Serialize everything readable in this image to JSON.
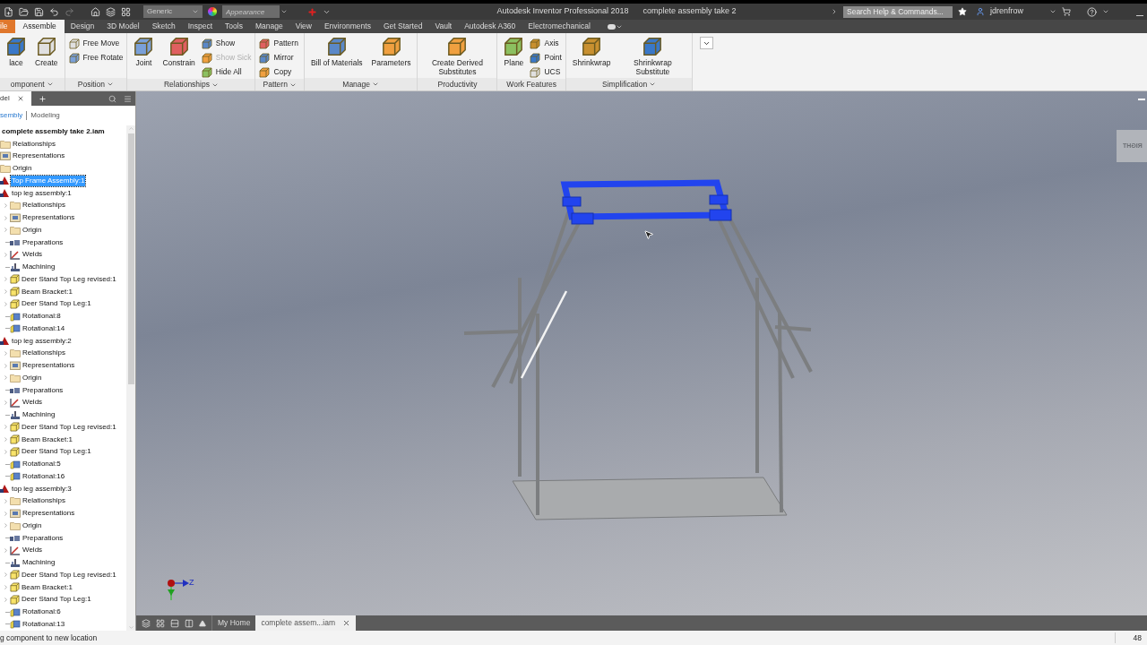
{
  "title_bar": {
    "app": "Autodesk Inventor Professional 2018",
    "document": "complete assembly take 2",
    "material": "Generic",
    "appearance": {
      "placeholder": "Appearance"
    },
    "search": {
      "placeholder": "Search Help & Commands..."
    },
    "user": "jdrenfrow"
  },
  "ribbon_tabs": [
    {
      "label": "ile",
      "selected": false,
      "kind": "file"
    },
    {
      "label": "Assemble",
      "selected": true,
      "kind": "tab"
    },
    {
      "label": "Design",
      "selected": false,
      "kind": "tab"
    },
    {
      "label": "3D Model",
      "selected": false,
      "kind": "tab"
    },
    {
      "label": "Sketch",
      "selected": false,
      "kind": "tab"
    },
    {
      "label": "Inspect",
      "selected": false,
      "kind": "tab"
    },
    {
      "label": "Tools",
      "selected": false,
      "kind": "tab"
    },
    {
      "label": "Manage",
      "selected": false,
      "kind": "tab"
    },
    {
      "label": "View",
      "selected": false,
      "kind": "tab"
    },
    {
      "label": "Environments",
      "selected": false,
      "kind": "tab"
    },
    {
      "label": "Get Started",
      "selected": false,
      "kind": "tab"
    },
    {
      "label": "Vault",
      "selected": false,
      "kind": "tab"
    },
    {
      "label": "Autodesk A360",
      "selected": false,
      "kind": "tab"
    },
    {
      "label": "Electromechanical",
      "selected": false,
      "kind": "tab"
    }
  ],
  "ribbon_panels": [
    {
      "label": "omponent",
      "menu": true,
      "buttons": [
        {
          "label": "lace",
          "kind": "large",
          "disabled": false
        },
        {
          "label": "Create",
          "kind": "large",
          "disabled": false
        }
      ]
    },
    {
      "label": "Position",
      "menu": true,
      "buttons": [
        {
          "label": "Free Move",
          "kind": "small",
          "disabled": false
        },
        {
          "label": "Free Rotate",
          "kind": "small",
          "disabled": false
        }
      ]
    },
    {
      "label": "Relationships",
      "menu": true,
      "buttons": [
        {
          "label": "Joint",
          "kind": "large",
          "disabled": false
        },
        {
          "label": "Constrain",
          "kind": "large",
          "disabled": false
        },
        {
          "label": "Show",
          "kind": "small",
          "disabled": false
        },
        {
          "label": "Show Sick",
          "kind": "small",
          "disabled": true
        },
        {
          "label": "Hide All",
          "kind": "small",
          "disabled": false
        }
      ]
    },
    {
      "label": "Pattern",
      "menu": true,
      "buttons": [
        {
          "label": "Pattern",
          "kind": "small",
          "disabled": false
        },
        {
          "label": "Mirror",
          "kind": "small",
          "disabled": false
        },
        {
          "label": "Copy",
          "kind": "small",
          "disabled": false
        }
      ]
    },
    {
      "label": "Manage",
      "menu": true,
      "buttons": [
        {
          "label": "Bill of Materials",
          "kind": "large",
          "disabled": false
        },
        {
          "label": "Parameters",
          "kind": "large",
          "disabled": false
        }
      ]
    },
    {
      "label": "Productivity",
      "menu": false,
      "buttons": [
        {
          "label": "Create Derived Substitutes",
          "kind": "large",
          "disabled": false
        }
      ]
    },
    {
      "label": "Work Features",
      "menu": false,
      "buttons": [
        {
          "label": "Plane",
          "kind": "large",
          "disabled": false
        },
        {
          "label": "Axis",
          "kind": "small",
          "disabled": false
        },
        {
          "label": "Point",
          "kind": "small",
          "disabled": false
        },
        {
          "label": "UCS",
          "kind": "small",
          "disabled": false
        }
      ]
    },
    {
      "label": "Simplification",
      "menu": true,
      "buttons": [
        {
          "label": "Shrinkwrap",
          "kind": "large",
          "disabled": false
        },
        {
          "label": "Shrinkwrap Substitute",
          "kind": "large",
          "disabled": false
        }
      ]
    }
  ],
  "browser": {
    "tab": "del",
    "views": [
      {
        "label": "sembly",
        "selected": true
      },
      {
        "label": "Modeling",
        "selected": false
      }
    ],
    "tree": {
      "title": "complete assembly take 2.iam",
      "items": [
        {
          "label": "Relationships",
          "kind": "folder",
          "selected": false
        },
        {
          "label": "Representations",
          "kind": "representations",
          "selected": false
        },
        {
          "label": "Origin",
          "kind": "folder",
          "selected": false
        },
        {
          "label": "Top Frame Assembly:1",
          "kind": "assembly",
          "selected": true
        },
        {
          "label": "top leg assembly:1",
          "kind": "assembly",
          "selected": false,
          "children": [
            {
              "label": "Relationships",
              "kind": "folder",
              "expandable": true
            },
            {
              "label": "Representations",
              "kind": "representations",
              "expandable": true
            },
            {
              "label": "Origin",
              "kind": "folder",
              "expandable": true
            },
            {
              "label": "Preparations",
              "kind": "preparations",
              "expandable": false
            },
            {
              "label": "Welds",
              "kind": "welds",
              "expandable": true
            },
            {
              "label": "Machining",
              "kind": "machining",
              "expandable": false
            },
            {
              "label": "Deer Stand Top Leg revised:1",
              "kind": "part",
              "expandable": true
            },
            {
              "label": "Beam Bracket:1",
              "kind": "part",
              "expandable": true
            },
            {
              "label": "Deer Stand Top Leg:1",
              "kind": "part",
              "expandable": true
            },
            {
              "label": "Rotational:8",
              "kind": "joint",
              "expandable": false
            },
            {
              "label": "Rotational:14",
              "kind": "joint",
              "expandable": false
            }
          ]
        },
        {
          "label": "top leg assembly:2",
          "kind": "assembly",
          "selected": false,
          "children": [
            {
              "label": "Relationships",
              "kind": "folder",
              "expandable": true
            },
            {
              "label": "Representations",
              "kind": "representations",
              "expandable": true
            },
            {
              "label": "Origin",
              "kind": "folder",
              "expandable": true
            },
            {
              "label": "Preparations",
              "kind": "preparations",
              "expandable": false
            },
            {
              "label": "Welds",
              "kind": "welds",
              "expandable": true
            },
            {
              "label": "Machining",
              "kind": "machining",
              "expandable": false
            },
            {
              "label": "Deer Stand Top Leg revised:1",
              "kind": "part",
              "expandable": true
            },
            {
              "label": "Beam Bracket:1",
              "kind": "part",
              "expandable": true
            },
            {
              "label": "Deer Stand Top Leg:1",
              "kind": "part",
              "expandable": true
            },
            {
              "label": "Rotational:5",
              "kind": "joint",
              "expandable": false
            },
            {
              "label": "Rotational:16",
              "kind": "joint",
              "expandable": false
            }
          ]
        },
        {
          "label": "top leg assembly:3",
          "kind": "assembly",
          "selected": false,
          "children": [
            {
              "label": "Relationships",
              "kind": "folder",
              "expandable": true
            },
            {
              "label": "Representations",
              "kind": "representations",
              "expandable": true
            },
            {
              "label": "Origin",
              "kind": "folder",
              "expandable": true
            },
            {
              "label": "Preparations",
              "kind": "preparations",
              "expandable": false
            },
            {
              "label": "Welds",
              "kind": "welds",
              "expandable": true
            },
            {
              "label": "Machining",
              "kind": "machining",
              "expandable": false
            },
            {
              "label": "Deer Stand Top Leg revised:1",
              "kind": "part",
              "expandable": true
            },
            {
              "label": "Beam Bracket:1",
              "kind": "part",
              "expandable": true
            },
            {
              "label": "Deer Stand Top Leg:1",
              "kind": "part",
              "expandable": true
            },
            {
              "label": "Rotational:6",
              "kind": "joint",
              "expandable": false
            },
            {
              "label": "Rotational:13",
              "kind": "joint",
              "expandable": false
            }
          ]
        }
      ]
    }
  },
  "viewport": {
    "view_cube": "RIGHT",
    "axis": "Z"
  },
  "document_tabs": [
    {
      "label": "My Home",
      "selected": false,
      "closable": false
    },
    {
      "label": "complete assem...iam",
      "selected": true,
      "closable": true
    }
  ],
  "status_bar": {
    "message": "g component to new location",
    "count": "48"
  }
}
